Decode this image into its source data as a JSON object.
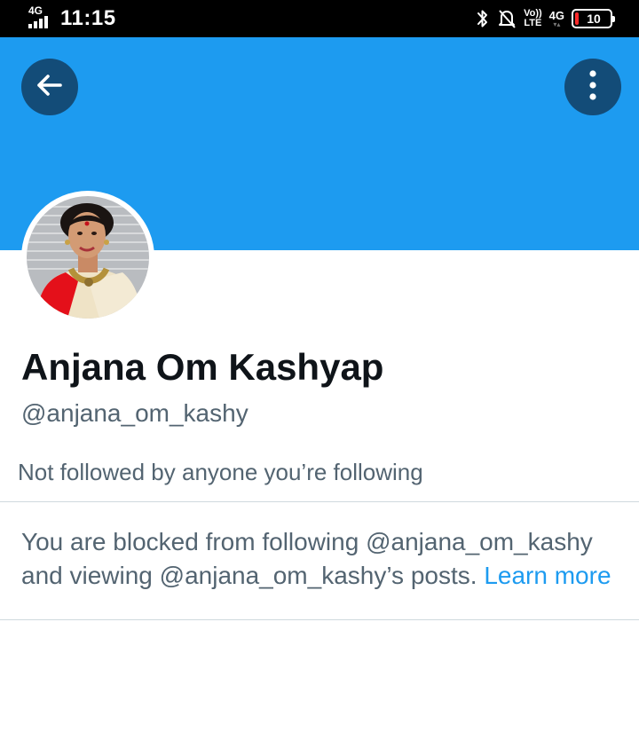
{
  "status_bar": {
    "network_left": "4G",
    "time": "11:15",
    "volte_top": "Vo))",
    "volte_bottom": "LTE",
    "network_right": "4G",
    "battery_level": "10",
    "battery_color": "#ff2a2a"
  },
  "header": {
    "back_icon": "arrow-left-icon",
    "more_icon": "vertical-ellipsis-icon",
    "banner_color": "#1d9bf0"
  },
  "profile": {
    "name": "Anjana Om Kashyap",
    "handle": "@anjana_om_kashy",
    "followed_by": "Not followed by anyone you’re following"
  },
  "block_notice": {
    "text": "You are blocked from following @anjana_om_kashy and viewing @anjana_om_kashy’s posts.",
    "link": "Learn more",
    "link_color": "#1d9bf0"
  }
}
